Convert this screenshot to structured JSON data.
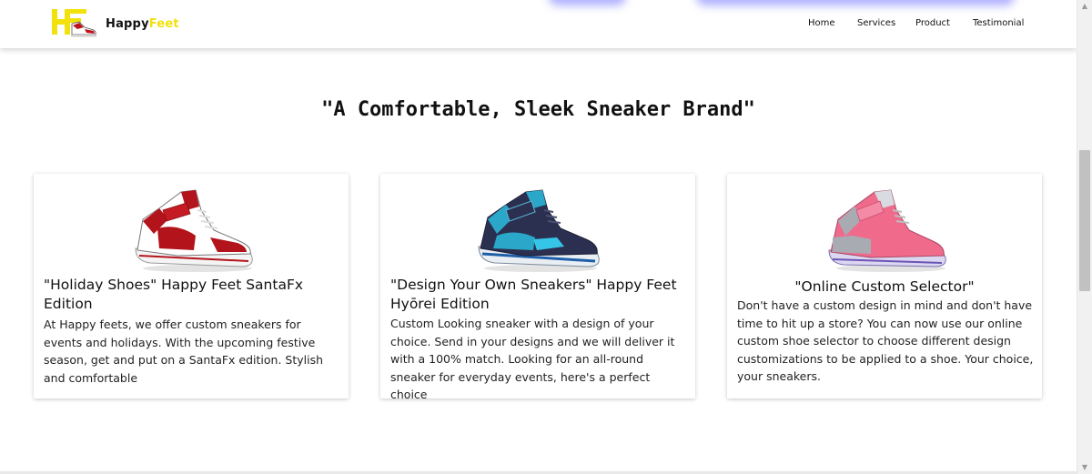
{
  "navbar": {
    "brand_part1": "Happy",
    "brand_part2": "Feet",
    "logo_icon": "hf-sneaker-logo-icon",
    "links": [
      {
        "label": "Home"
      },
      {
        "label": "Services"
      },
      {
        "label": "Product"
      },
      {
        "label": "Testimonial"
      }
    ]
  },
  "main": {
    "headline": "\"A Comfortable, Sleek Sneaker Brand\""
  },
  "cards": [
    {
      "image_icon": "red-white-high-top-sneaker",
      "title": "\"Holiday Shoes\" Happy Feet SantaFx Edition",
      "body": "At Happy feets, we offer custom sneakers for events and holidays. With the upcoming festive season, get and put on a SantaFx edition. Stylish and comfortable"
    },
    {
      "image_icon": "blue-navy-high-top-sneaker",
      "title": "\"Design Your Own Sneakers\" Happy Feet Hyōrei Edition",
      "body": "Custom Looking sneaker with a design of your choice. Send in your designs and we will deliver it with a 100% match. Looking for an all-round sneaker for everyday events, here's a perfect choice"
    },
    {
      "image_icon": "pink-grey-high-top-sneaker",
      "title": "\"Online Custom Selector\"",
      "body": "Don't have a custom design in mind and don't have time to hit up a store? You can now use our online custom shoe selector to choose different design customizations to be applied to a shoe. Your choice, your sneakers."
    }
  ],
  "colors": {
    "brand_yellow": "#f2e10a",
    "glow_blue": "#6e6eff",
    "shoe_red": "#b3141c",
    "shoe_blue": "#2aa7c9",
    "shoe_navy": "#2c3050",
    "shoe_pink": "#f06a8c",
    "shoe_grey": "#a9abb3"
  }
}
